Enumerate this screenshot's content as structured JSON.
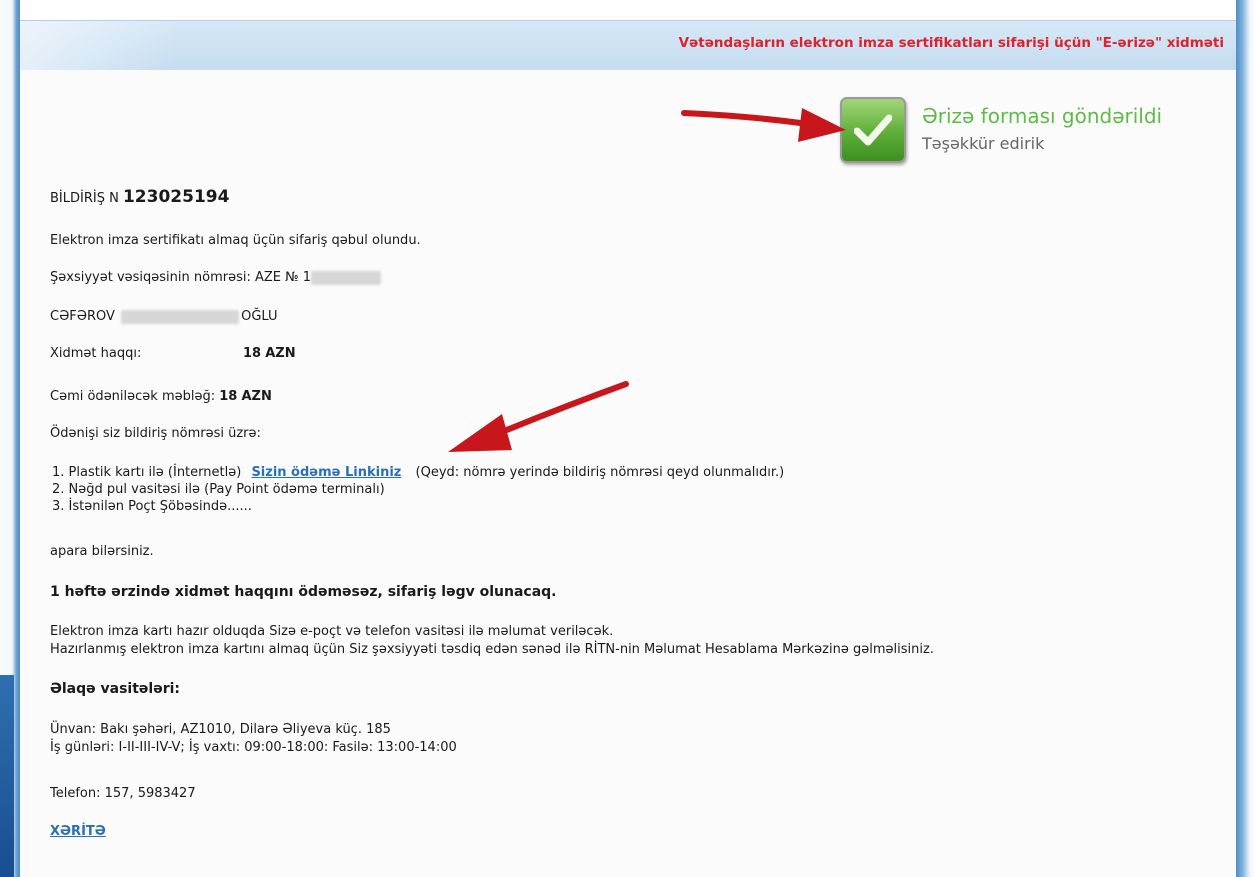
{
  "service_title": "Vətəndaşların elektron imza sertifikatları sifarişi üçün \"E-ərizə\" xidməti",
  "success": {
    "title": "Ərizə forması göndərildi",
    "subtitle": "Təşəkkür edirik",
    "icon": "checkmark-icon"
  },
  "notice": {
    "label": "BİLDİRİŞ N",
    "number": "123025194"
  },
  "order_accepted": "Elektron imza sertifikatı almaq üçün sifariş qəbul olundu.",
  "id_card": {
    "label": "Şəxsiyyət vəsiqəsinin nömrəsi: AZE № 1"
  },
  "person": {
    "surname": "CƏFƏROV",
    "suffix": "OĞLU"
  },
  "fee": {
    "label": "Xidmət haqqı:",
    "amount": "18",
    "currency": "AZN"
  },
  "total": {
    "label": "Cəmi ödəniləcək məbləğ:",
    "amount": "18",
    "currency": "AZN"
  },
  "payment_intro": "Ödənişi siz bildiriş nömrəsi üzrə:",
  "payment_methods": [
    {
      "num": "1.",
      "text": "Plastik kartı ilə (İnternetlə)",
      "link": "Sizin ödəmə Linkiniz",
      "note": "(Qeyd: nömrə yerində bildiriş nömrəsi qeyd olunmalıdır.)"
    },
    {
      "num": "2.",
      "text": "Nəğd pul vasitəsi ilə (Pay Point ödəmə terminalı)"
    },
    {
      "num": "3.",
      "text": "İstənilən Poçt Şöbəsində......"
    }
  ],
  "payment_outro": "apara bilərsiniz.",
  "warning": "1 həftə ərzində xidmət haqqını ödəməsəz, sifariş ləgv olunacaq.",
  "info_lines": [
    "Elektron imza kartı hazır olduqda Sizə e-poçt və telefon vasitəsi ilə məlumat veriləcək.",
    "Hazırlanmış elektron imza kartını almaq üçün Siz şəxsiyyəti təsdiq edən sənəd ilə RİTN-nin Məlumat Hesablama Mərkəzinə gəlməlisiniz."
  ],
  "contacts": {
    "heading": "Əlaqə vasitələri:",
    "address": "Ünvan: Bakı şəhəri, AZ1010, Dilarə Əliyeva küç. 185",
    "hours": "İş günləri: I-II-III-IV-V; İş vaxtı: 09:00-18:00: Fasilə: 13:00-14:00",
    "phone": "Telefon: 157, 5983427",
    "map_link": "XƏRİTƏ"
  },
  "colors": {
    "title_red": "#e0202a",
    "success_green": "#5ebb48",
    "link_blue": "#2a6fb8",
    "arrow_red": "#c8161d"
  }
}
